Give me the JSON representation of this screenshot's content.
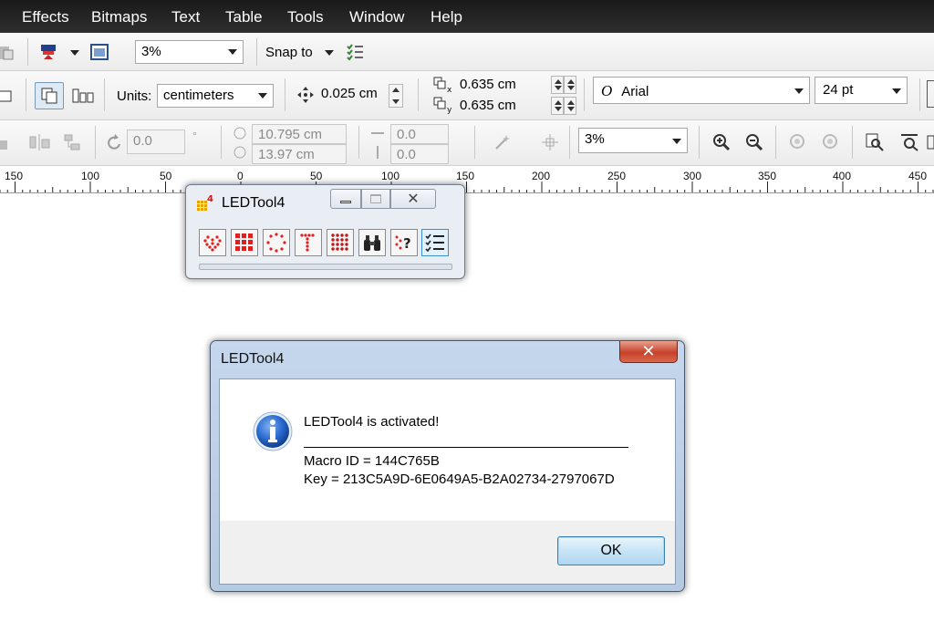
{
  "menubar": {
    "items": [
      "Effects",
      "Bitmaps",
      "Text",
      "Table",
      "Tools",
      "Window",
      "Help"
    ]
  },
  "toolbar1": {
    "zoom_value": "3%",
    "snap_label": "Snap to"
  },
  "propertybar": {
    "units_label": "Units:",
    "units_value": "centimeters",
    "nudge_value": "0.025 cm",
    "dup_x": "0.635 cm",
    "dup_y": "0.635 cm",
    "font_name": "Arial",
    "font_size": "24 pt"
  },
  "toolbar3": {
    "rotation": "0.0",
    "width": "10.795 cm",
    "height": "13.97 cm",
    "skew_h": "0.0",
    "skew_v": "0.0",
    "zoom_value": "3%"
  },
  "ruler": {
    "labels": [
      "150",
      "100",
      "50",
      "0",
      "50",
      "100",
      "150",
      "200",
      "250",
      "300",
      "350",
      "400",
      "450"
    ]
  },
  "led_panel": {
    "title": "LEDTool4",
    "close_glyph": "✕"
  },
  "dialog": {
    "title": "LEDTool4",
    "close_glyph": "✕",
    "message_line1": "LEDTool4 is activated!",
    "message_line2": "Macro ID = 144C765B",
    "message_line3": "Key = 213C5A9D-6E0649A5-B2A02734-2797067D",
    "ok_label": "OK"
  },
  "colors": {
    "menubar_bg": "#232323",
    "dialog_frame": "#b5c9e0",
    "close_red": "#c6412a",
    "info_blue": "#1f5fbf",
    "led_red": "#e02020"
  }
}
